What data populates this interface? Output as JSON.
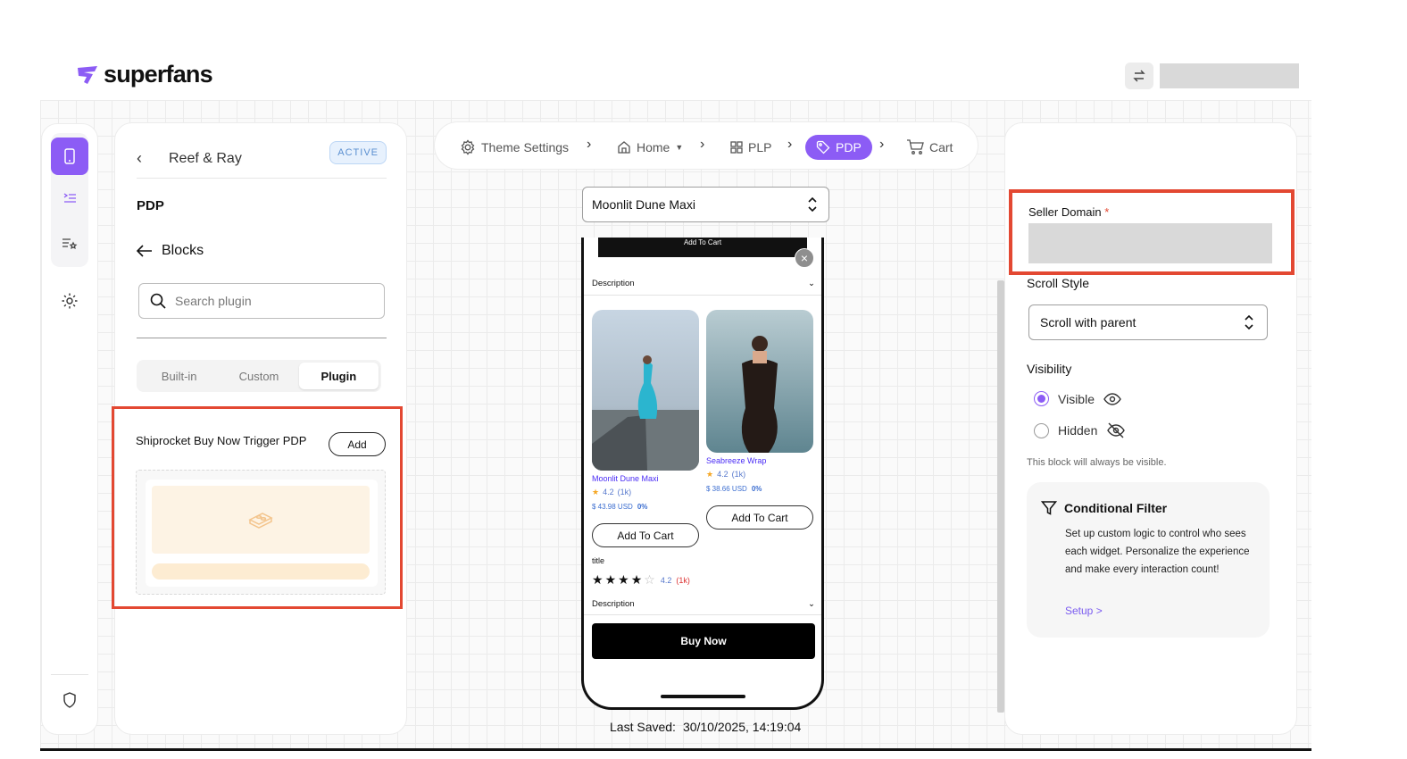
{
  "brand": {
    "name": "superfans",
    "accent": "#8c5cf5",
    "highlight": "#e34832"
  },
  "header": {
    "swap_icon": "swap-arrows-icon"
  },
  "rail": {
    "items": [
      "mobile-icon",
      "list-indent-icon",
      "list-star-icon",
      "gear-icon",
      "shield-icon"
    ]
  },
  "left_panel": {
    "store_name": "Reef & Ray",
    "status_badge": "ACTIVE",
    "section": "PDP",
    "back_label": "Blocks",
    "search_placeholder": "Search plugin",
    "tabs": [
      {
        "label": "Built-in",
        "active": false
      },
      {
        "label": "Custom",
        "active": false
      },
      {
        "label": "Plugin",
        "active": true
      }
    ],
    "plugin": {
      "name": "Shiprocket Buy Now Trigger PDP",
      "add_label": "Add"
    }
  },
  "breadcrumb": {
    "items": [
      {
        "label": "Theme Settings",
        "icon": "settings-icon"
      },
      {
        "label": "Home",
        "icon": "home-icon"
      },
      {
        "label": "PLP",
        "icon": "grid-icon"
      },
      {
        "label": "PDP",
        "icon": "tag-icon",
        "active": true
      },
      {
        "label": "Cart",
        "icon": "cart-icon"
      }
    ]
  },
  "preview": {
    "selected_product": "Moonlit Dune Maxi",
    "top_button": "Add To Cart",
    "description_label": "Description",
    "products": [
      {
        "name": "Moonlit Dune Maxi",
        "rating": "4.2",
        "count": "(1k)",
        "price": "$ 43.98 USD",
        "discount": "0%",
        "button": "Add To Cart"
      },
      {
        "name": "Seabreeze Wrap",
        "rating": "4.2",
        "count": "(1k)",
        "price": "$ 38.66 USD",
        "discount": "0%",
        "button": "Add To Cart"
      }
    ],
    "title_label": "title",
    "review": {
      "stars": 4,
      "rating": "4.2",
      "count": "(1k)"
    },
    "description_label_2": "Description",
    "buy_now": "Buy Now"
  },
  "saved": {
    "label": "Last Saved:",
    "value": "30/10/2025, 14:19:04"
  },
  "right_panel": {
    "seller_domain_label": "Seller Domain",
    "required_mark": "*",
    "scroll_style_label": "Scroll Style",
    "scroll_style_value": "Scroll with parent",
    "visibility_label": "Visibility",
    "visible_label": "Visible",
    "hidden_label": "Hidden",
    "visibility_selected": "Visible",
    "visibility_note": "This block will always be visible.",
    "filter": {
      "title": "Conditional Filter",
      "description": "Set up custom logic to control who sees each widget. Personalize the experience and make every interaction count!",
      "link": "Setup >"
    }
  }
}
